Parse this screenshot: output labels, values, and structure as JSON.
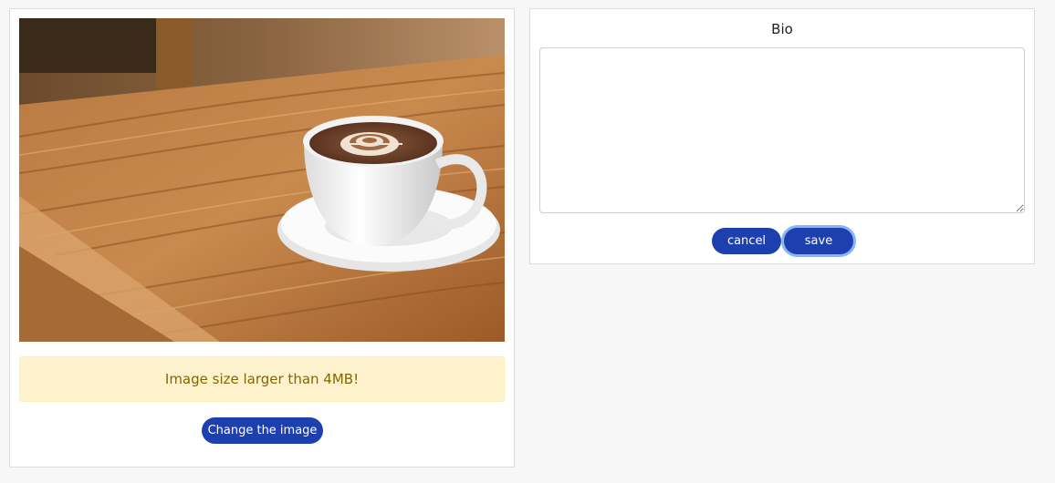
{
  "image_panel": {
    "photo_alt": "Coffee cup with latte art on wooden table",
    "alert_text": "Image size larger than 4MB!",
    "change_button_label": "Change the image"
  },
  "bio_panel": {
    "title": "Bio",
    "textarea_value": "",
    "cancel_label": "cancel",
    "save_label": "save"
  },
  "colors": {
    "button_bg": "#1e40af",
    "alert_bg": "#fff3cd",
    "alert_text": "#856404",
    "focus_ring": "#8ab4f8"
  }
}
